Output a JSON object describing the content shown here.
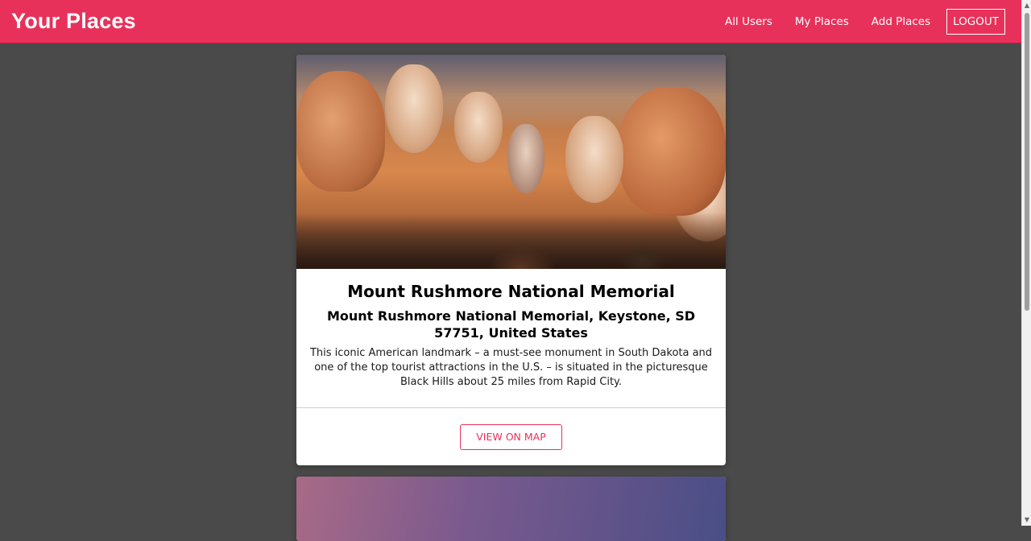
{
  "header": {
    "title": "Your Places",
    "brand_color": "#e8315a",
    "nav": {
      "all_users": "All Users",
      "my_places": "My Places",
      "add_places": "Add Places",
      "logout": "LOGOUT"
    }
  },
  "places": [
    {
      "image": "mount-rushmore-photo",
      "title": "Mount Rushmore National Memorial",
      "address": "Mount Rushmore National Memorial, Keystone, SD 57751, United States",
      "description": "This iconic American landmark – a must-see monument in South Dakota and one of the top tourist attractions in the U.S. – is situated in the picturesque Black Hills about 25 miles from Rapid City.",
      "action_label": "VIEW ON MAP"
    },
    {
      "image": "purple-sky-landscape-photo"
    }
  ],
  "icons": {
    "scroll_up": "scroll-up-arrow-icon",
    "scroll_down": "scroll-down-arrow-icon"
  }
}
